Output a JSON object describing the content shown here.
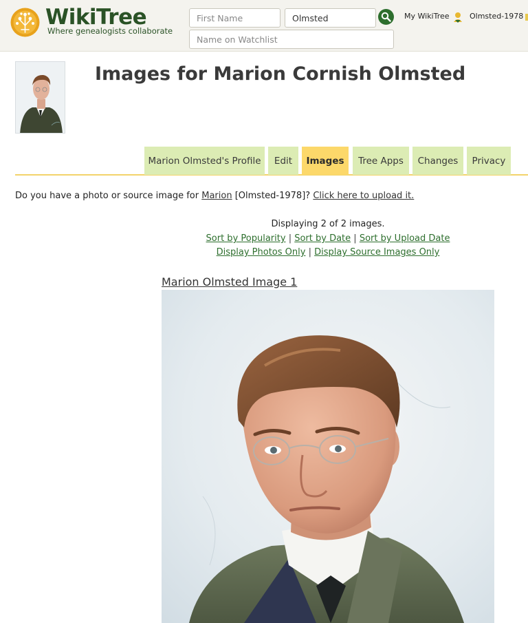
{
  "brand": {
    "name": "WikiTree",
    "tagline": "Where genealogists collaborate"
  },
  "search": {
    "first_name_placeholder": "First Name",
    "last_name_value": "Olmsted",
    "watchlist_placeholder": "Name on Watchlist"
  },
  "user_nav": {
    "my_wikitree": "My WikiTree",
    "user_id": "Olmsted-1978"
  },
  "page": {
    "title": "Images for Marion Cornish Olmsted"
  },
  "tabs": [
    {
      "label": "Marion Olmsted's Profile",
      "active": false
    },
    {
      "label": "Edit",
      "active": false
    },
    {
      "label": "Images",
      "active": true
    },
    {
      "label": "Tree Apps",
      "active": false
    },
    {
      "label": "Changes",
      "active": false
    },
    {
      "label": "Privacy",
      "active": false
    }
  ],
  "upload": {
    "prefix": "Do you have a photo or source image for ",
    "name_link": "Marion",
    "middle": " [Olmsted-1978]? ",
    "upload_link": "Click here to upload it."
  },
  "gallery": {
    "displaying": "Displaying 2 of 2 images.",
    "sort_popularity": "Sort by Popularity",
    "sort_date": "Sort by Date",
    "sort_upload": "Sort by Upload Date",
    "photos_only": "Display Photos Only",
    "sources_only": "Display Source Images Only",
    "separator": "|",
    "image1_title": "Marion Olmsted Image 1"
  },
  "colors": {
    "brand_green": "#2a5226",
    "link_green": "#2d6e2d",
    "tab_inactive": "#dcecb4",
    "tab_active": "#fcd86a",
    "tab_rule": "#f3d36a",
    "header_bg": "#f4f3ee"
  },
  "icons": {
    "logo": "tree-logo-icon",
    "search": "magnifier-icon",
    "user": "user-badge-icon"
  }
}
